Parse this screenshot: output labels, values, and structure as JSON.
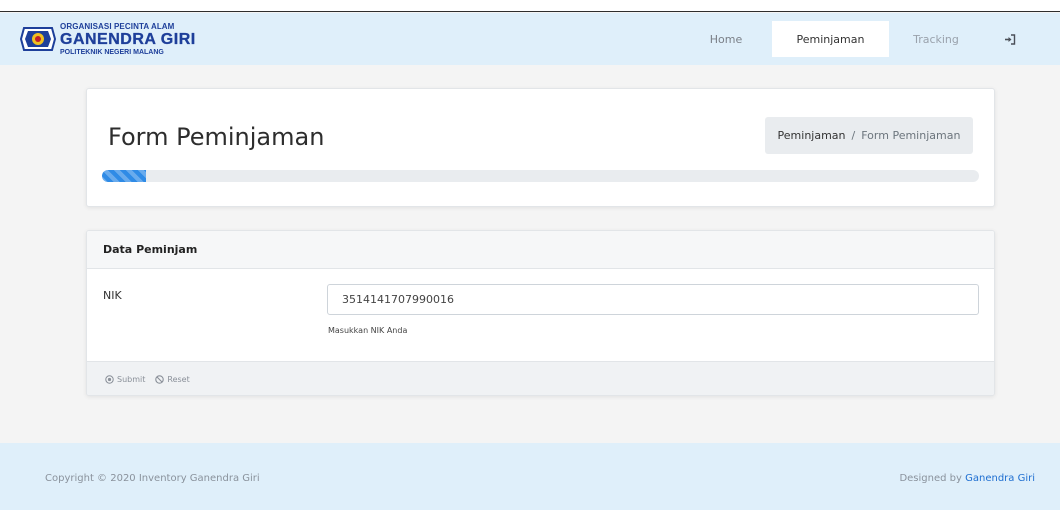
{
  "brand": {
    "line1": "ORGANISASI PECINTA ALAM",
    "line2": "GANENDRA GIRI",
    "line3": "POLITEKNIK NEGERI MALANG"
  },
  "nav": {
    "items": [
      {
        "label": "Home",
        "active": false
      },
      {
        "label": "Peminjaman",
        "active": true
      },
      {
        "label": "Tracking",
        "active": false
      }
    ],
    "login_icon": "sign-in-icon"
  },
  "page": {
    "title": "Form Peminjaman",
    "breadcrumb": {
      "parent": "Peminjaman",
      "separator": "/",
      "current": "Form Peminjaman"
    },
    "progress_fraction": 0.05
  },
  "form": {
    "header": "Data Peminjam",
    "nik_label": "NIK",
    "nik_value": "3514141707990016",
    "nik_help": "Masukkan NIK Anda",
    "submit_label": "Submit",
    "reset_label": "Reset"
  },
  "footer": {
    "copyright": "Copyright © 2020 Inventory Ganendra Giri",
    "designed_prefix": "Designed by",
    "designed_link": "Ganendra Giri"
  },
  "colors": {
    "nav_bg": "#dfeffa",
    "progress": "#2f8be6",
    "link": "#1f6fd1"
  }
}
